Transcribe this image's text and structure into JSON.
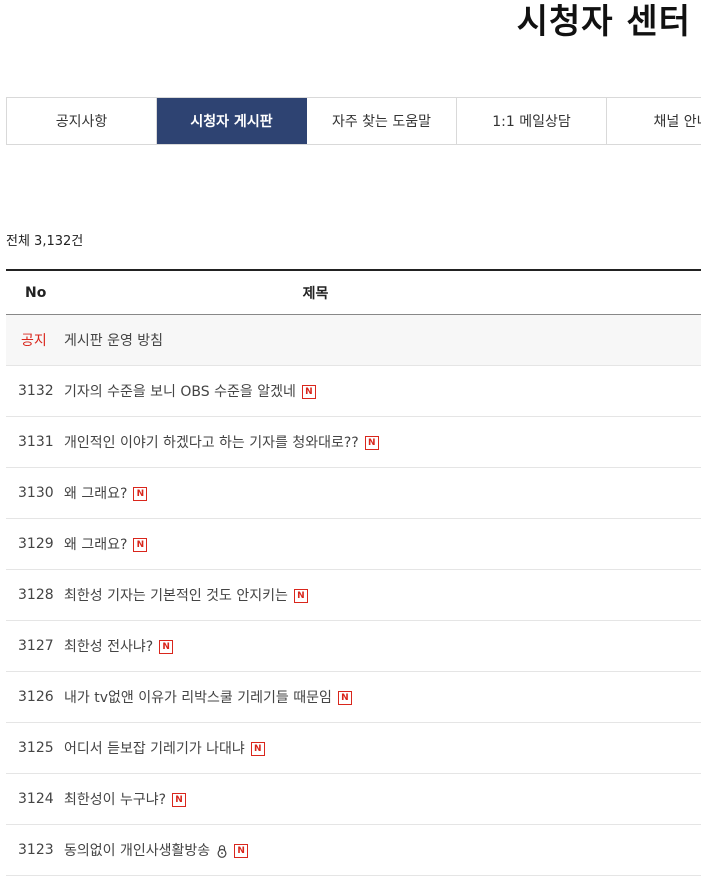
{
  "header": {
    "title": "시청자 센터"
  },
  "tabs": [
    {
      "label": "공지사항",
      "active": false
    },
    {
      "label": "시청자 게시판",
      "active": true
    },
    {
      "label": "자주 찾는 도움말",
      "active": false
    },
    {
      "label": "1:1 메일상담",
      "active": false
    },
    {
      "label": "채널 안내",
      "active": false
    }
  ],
  "board": {
    "total_label": "전체 3,132건",
    "columns": {
      "no": "No",
      "title": "제목"
    },
    "notice": {
      "no": "공지",
      "title": "게시판 운영 방침"
    },
    "new_badge": "N",
    "rows": [
      {
        "no": "3132",
        "title": "기자의 수준을 보니 OBS 수준을 알겠네",
        "new": true,
        "locked": false
      },
      {
        "no": "3131",
        "title": "개인적인 이야기 하겠다고 하는 기자를 청와대로??",
        "new": true,
        "locked": false
      },
      {
        "no": "3130",
        "title": "왜 그래요?",
        "new": true,
        "locked": false
      },
      {
        "no": "3129",
        "title": "왜 그래요?",
        "new": true,
        "locked": false
      },
      {
        "no": "3128",
        "title": "최한성 기자는 기본적인 것도 안지키는",
        "new": true,
        "locked": false
      },
      {
        "no": "3127",
        "title": "최한성 전사냐?",
        "new": true,
        "locked": false
      },
      {
        "no": "3126",
        "title": "내가 tv없앤 이유가 리박스쿨 기레기들 때문임",
        "new": true,
        "locked": false
      },
      {
        "no": "3125",
        "title": "어디서 듣보잡 기레기가 나대냐",
        "new": true,
        "locked": false
      },
      {
        "no": "3124",
        "title": "최한성이 누구냐?",
        "new": true,
        "locked": false
      },
      {
        "no": "3123",
        "title": "동의없이 개인사생활방송",
        "new": true,
        "locked": true
      }
    ]
  },
  "colors": {
    "active_tab": "#2e4372",
    "notice_red": "#d9261c",
    "new_badge": "#d9261c"
  }
}
